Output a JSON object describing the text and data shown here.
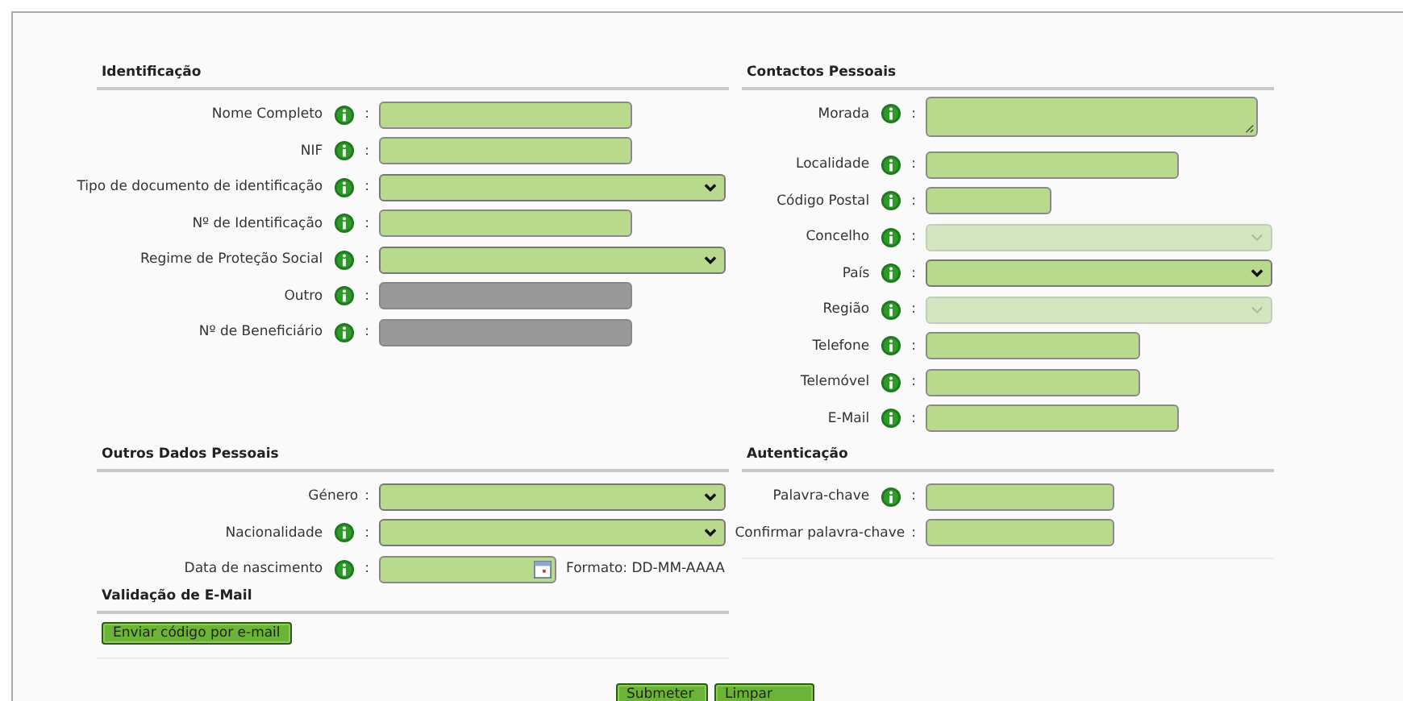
{
  "sections": [
    {
      "title": "Identificação",
      "fields": [
        {
          "label": "Nome Completo",
          "info": true,
          "colon": ":",
          "kind": "text",
          "disabled": false
        },
        {
          "label": "NIF",
          "info": true,
          "colon": ":",
          "kind": "text",
          "disabled": false
        },
        {
          "label": "Tipo de documento de identificação",
          "info": true,
          "colon": ":",
          "kind": "select",
          "disabled": false
        },
        {
          "label": "Nº de Identificação",
          "info": true,
          "colon": ":",
          "kind": "text",
          "disabled": false
        },
        {
          "label": "Regime de Proteção Social",
          "info": true,
          "colon": ":",
          "kind": "select",
          "disabled": false
        },
        {
          "label": "Outro",
          "info": true,
          "colon": ":",
          "kind": "text",
          "disabled": true
        },
        {
          "label": "Nº de Beneficiário",
          "info": true,
          "colon": ":",
          "kind": "text",
          "disabled": true
        }
      ]
    },
    {
      "title": "Contactos Pessoais",
      "fields": [
        {
          "label": "Morada",
          "info": true,
          "colon": ":",
          "kind": "textarea",
          "disabled": false
        },
        {
          "label": "Localidade",
          "info": true,
          "colon": ":",
          "kind": "text",
          "disabled": false
        },
        {
          "label": "Código Postal",
          "info": true,
          "colon": ":",
          "kind": "text",
          "disabled": false
        },
        {
          "label": "Concelho",
          "info": true,
          "colon": ":",
          "kind": "select",
          "disabled": true
        },
        {
          "label": "País",
          "info": true,
          "colon": ":",
          "kind": "select",
          "disabled": false
        },
        {
          "label": "Região",
          "info": true,
          "colon": ":",
          "kind": "select",
          "disabled": true
        },
        {
          "label": "Telefone",
          "info": true,
          "colon": ":",
          "kind": "text",
          "disabled": false
        },
        {
          "label": "Telemóvel",
          "info": true,
          "colon": ":",
          "kind": "text",
          "disabled": false
        },
        {
          "label": "E-Mail",
          "info": true,
          "colon": ":",
          "kind": "text",
          "disabled": false
        }
      ]
    },
    {
      "title": "Outros Dados Pessoais",
      "fields": [
        {
          "label": "Género",
          "info": false,
          "colon": ":",
          "kind": "select",
          "disabled": false
        },
        {
          "label": "Nacionalidade",
          "info": true,
          "colon": ":",
          "kind": "select",
          "disabled": false
        },
        {
          "label": "Data de nascimento",
          "info": true,
          "colon": ":",
          "kind": "date",
          "disabled": false,
          "hint": "Formato: DD-MM-AAAA"
        }
      ]
    },
    {
      "title": "Autenticação",
      "fields": [
        {
          "label": "Palavra-chave",
          "info": true,
          "colon": ":",
          "kind": "text",
          "disabled": false
        },
        {
          "label": "Confirmar palavra-chave",
          "info": false,
          "colon": ":",
          "kind": "text",
          "disabled": false
        }
      ]
    }
  ],
  "email_validation": {
    "title": "Validação de E-Mail",
    "button": "Enviar código por e-mail"
  },
  "buttons": [
    "Submeter",
    "Limpar"
  ]
}
